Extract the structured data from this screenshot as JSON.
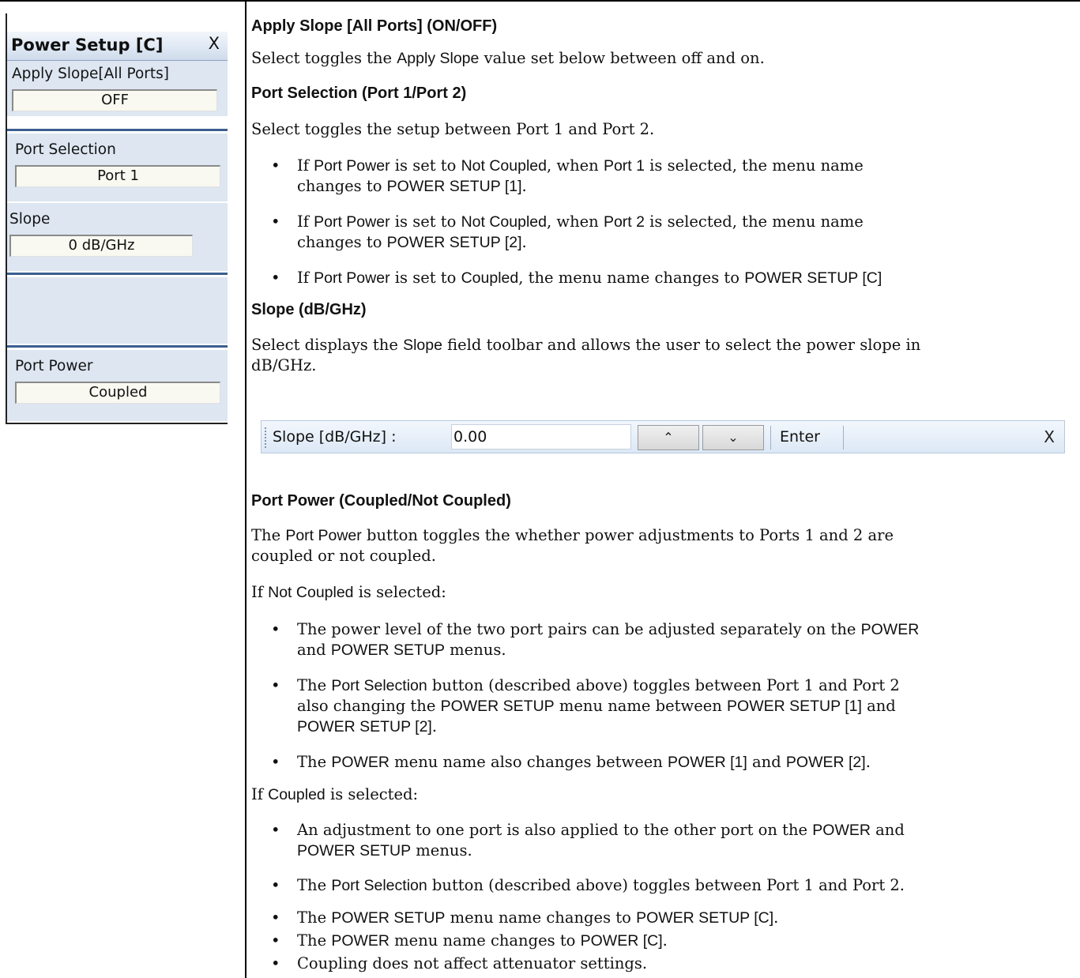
{
  "menu": {
    "title": "Power Setup [C]",
    "close": "X",
    "apply_slope": {
      "label": "Apply Slope[All Ports]",
      "value": "OFF"
    },
    "port_selection": {
      "label": "Port Selection",
      "value": "Port 1"
    },
    "slope": {
      "label": "Slope",
      "value": "0   dB/GHz"
    },
    "port_power": {
      "label": "Port Power",
      "value": "Coupled"
    }
  },
  "doc": {
    "s1": {
      "heading": "Apply Slope [All Ports] (ON/OFF)",
      "p1": [
        "Select toggles the ",
        "Apply Slope",
        " value set below between off and on."
      ]
    },
    "s2": {
      "heading": "Port Selection (Port 1/Port 2)",
      "p1": "Select toggles the setup between Port 1 and Port 2.",
      "b1": {
        "l1": [
          "If ",
          "Port Power",
          " is set to ",
          "Not Coupled",
          ", when ",
          "Port 1",
          " is selected, the menu name"
        ],
        "l2": [
          "changes to ",
          "POWER SETUP [1]",
          "."
        ]
      },
      "b2": {
        "l1": [
          "If ",
          "Port Power",
          " is set to ",
          "Not Coupled",
          ", when ",
          "Port 2",
          " is selected, the menu name"
        ],
        "l2": [
          "changes to ",
          "POWER SETUP [2]",
          "."
        ]
      },
      "b3": {
        "l1": [
          "If ",
          "Port Power",
          " is set to ",
          "Coupled",
          ", the menu name changes to ",
          "POWER SETUP [C]"
        ]
      }
    },
    "s3": {
      "heading": "Slope (dB/GHz)",
      "l1": [
        "Select displays the ",
        "Slope",
        " field toolbar and allows the user to select the power slope in"
      ],
      "l2": "dB/GHz."
    },
    "toolbar": {
      "label": "Slope [dB/GHz]  :",
      "value": "0.00",
      "up": "⌃",
      "down": "⌄",
      "enter": "Enter",
      "close": "X"
    },
    "s4": {
      "heading": "Port Power (Coupled/Not Coupled)",
      "l1": [
        "The ",
        "Port Power",
        " button toggles the whether power adjustments to Ports 1 and 2 are"
      ],
      "l2": "coupled or not coupled.",
      "nc_intro": [
        "If ",
        "Not Coupled",
        " is selected:"
      ],
      "nc_b1": {
        "l1": [
          "The power level of the two port pairs can be adjusted separately on the ",
          "POWER"
        ],
        "l2": [
          "and ",
          "POWER SETUP",
          " menus."
        ]
      },
      "nc_b2": {
        "l1": [
          "The ",
          "Port Selection",
          " button (described above) toggles between Port 1 and Port 2"
        ],
        "l2": [
          "also changing the ",
          "POWER SETUP",
          " menu name between ",
          "POWER SETUP [1]",
          " and"
        ],
        "l3": [
          "POWER SETUP [2]",
          "."
        ]
      },
      "nc_b3": {
        "l1": [
          "The ",
          "POWER",
          " menu name also changes between ",
          "POWER [1]",
          " and ",
          "POWER [2]",
          "."
        ]
      },
      "c_intro": [
        "If ",
        "Coupled",
        " is selected:"
      ],
      "c_b1": {
        "l1": [
          "An adjustment to one port is also applied to the other port on the ",
          "POWER",
          " and"
        ],
        "l2": [
          "POWER SETUP",
          " menus."
        ]
      },
      "c_b2": {
        "l1": [
          "The ",
          "Port Selection",
          " button (described above) toggles between Port 1 and Port 2."
        ]
      },
      "c_b3": {
        "l1": [
          "The ",
          "POWER SETUP",
          " menu name changes to ",
          "POWER SETUP [C]",
          "."
        ]
      },
      "c_b4": {
        "l1": [
          "The ",
          "POWER",
          " menu name changes to ",
          "POWER [C]",
          "."
        ]
      },
      "c_b5": {
        "l1": [
          "Coupling does not affect attenuator settings."
        ]
      }
    },
    "bullet": "•"
  }
}
